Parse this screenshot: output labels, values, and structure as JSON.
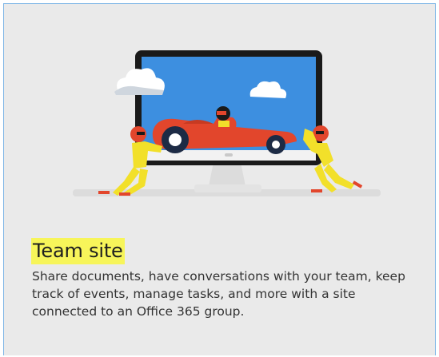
{
  "card": {
    "title": "Team site",
    "description": "Share documents, have conversations with your team, keep track of events, manage tasks, and more with a site connected to an Office 365 group.",
    "title_highlight_color": "#f7f55a",
    "border_color": "#7fb6e6",
    "background_color": "#eaeaea"
  },
  "illustration": {
    "subject": "race-car-on-monitor",
    "screen_color": "#3d8fe0",
    "car_color": "#e2462c",
    "figure_color": "#f2e02a"
  }
}
